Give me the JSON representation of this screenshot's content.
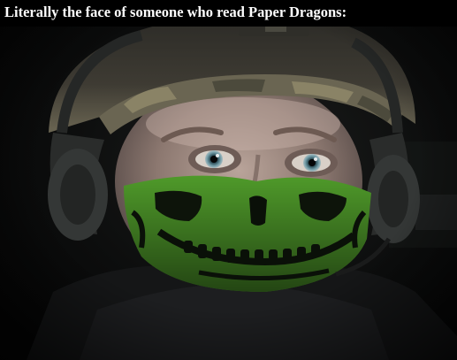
{
  "caption": {
    "text": "Literally the face of someone who read Paper Dragons:"
  },
  "photo": {
    "subject_icon": "soldier-portrait-image",
    "mask_color": "#4f9a2a",
    "helmet_color": "#5f5a44"
  }
}
